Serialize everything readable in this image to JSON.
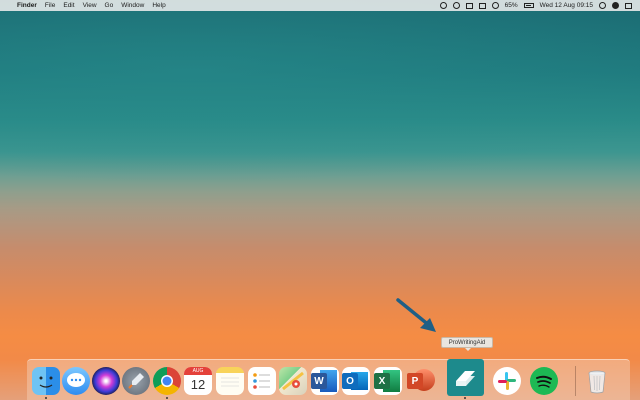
{
  "menubar": {
    "app_name": "Finder",
    "menus": [
      "File",
      "Edit",
      "View",
      "Go",
      "Window",
      "Help"
    ],
    "battery": "65%",
    "datetime": "Wed 12 Aug  09:15"
  },
  "tooltip": {
    "label": "ProWritingAid"
  },
  "calendar": {
    "month": "AUG",
    "day": "12"
  },
  "dock": {
    "items": [
      "finder-icon",
      "messages-icon",
      "siri-icon",
      "launchpad-icon",
      "chrome-icon",
      "calendar-icon",
      "notes-icon",
      "reminders-icon",
      "maps-icon",
      "word-icon",
      "outlook-icon",
      "excel-icon",
      "powerpoint-icon",
      "prowritingaid-icon",
      "slack-icon",
      "spotify-icon",
      "trash-icon"
    ]
  },
  "colors": {
    "word": "#2b579a",
    "outlook": "#0f6cbd",
    "excel": "#1f7145",
    "powerpoint": "#d24726",
    "prowritingaid": "#1d8a8c",
    "spotify": "#1db954"
  }
}
